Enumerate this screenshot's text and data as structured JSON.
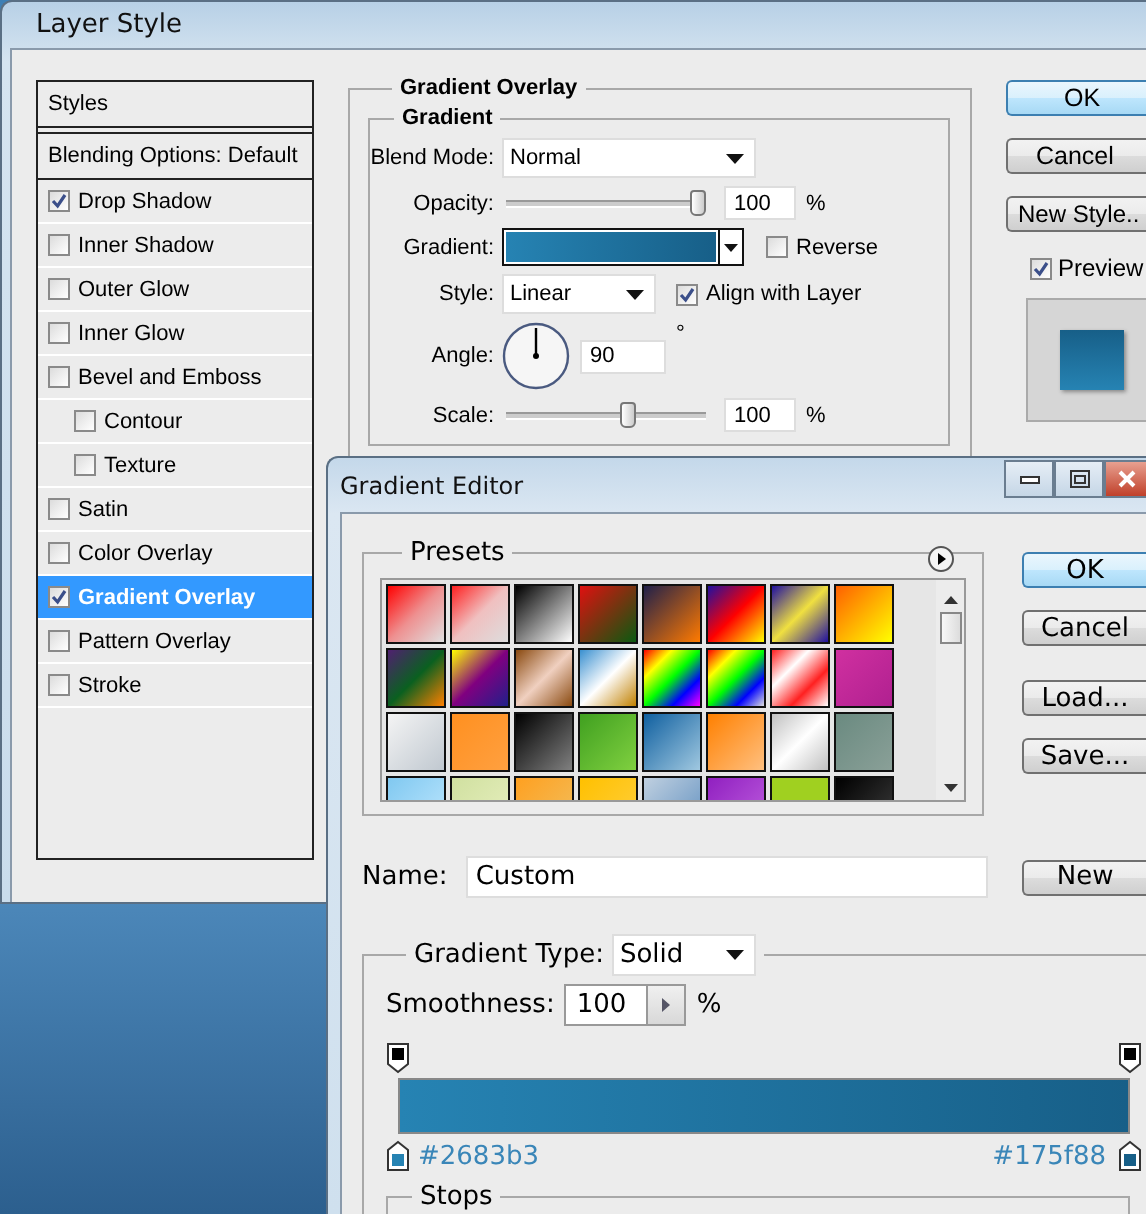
{
  "layer_style": {
    "title": "Layer Style",
    "styles_header": "Styles",
    "blending_options": "Blending Options: Default",
    "effects": [
      {
        "label": "Drop Shadow",
        "checked": true,
        "selected": false
      },
      {
        "label": "Inner Shadow",
        "checked": false,
        "selected": false
      },
      {
        "label": "Outer Glow",
        "checked": false,
        "selected": false
      },
      {
        "label": "Inner Glow",
        "checked": false,
        "selected": false
      },
      {
        "label": "Bevel and Emboss",
        "checked": false,
        "selected": false,
        "children": [
          {
            "label": "Contour",
            "checked": false,
            "selected": false
          },
          {
            "label": "Texture",
            "checked": false,
            "selected": false
          }
        ]
      },
      {
        "label": "Satin",
        "checked": false,
        "selected": false
      },
      {
        "label": "Color Overlay",
        "checked": false,
        "selected": false
      },
      {
        "label": "Gradient Overlay",
        "checked": true,
        "selected": true
      },
      {
        "label": "Pattern Overlay",
        "checked": false,
        "selected": false
      },
      {
        "label": "Stroke",
        "checked": false,
        "selected": false
      }
    ],
    "section_title": "Gradient Overlay",
    "group_title": "Gradient",
    "blend_mode": {
      "label": "Blend Mode:",
      "value": "Normal"
    },
    "opacity": {
      "label": "Opacity:",
      "level": 1,
      "value": "100",
      "unit": "%"
    },
    "gradient": {
      "label": "Gradient:",
      "stops": [
        {
          "color": "#2683b3"
        },
        {
          "color": "#175f88"
        }
      ]
    },
    "reverse": {
      "label": "Reverse",
      "checked": false
    },
    "style": {
      "label": "Style:",
      "value": "Linear"
    },
    "align_with_layer": {
      "label": "Align with Layer",
      "checked": true
    },
    "angle": {
      "label": "Angle:",
      "value": "90",
      "unit": "°"
    },
    "scale": {
      "label": "Scale:",
      "level": 0.62,
      "value": "100",
      "unit": "%"
    },
    "buttons": [
      {
        "label": "OK",
        "default": true
      },
      {
        "label": "Cancel",
        "default": false
      },
      {
        "label": "New Style..",
        "default": false
      }
    ],
    "preview": {
      "label": "Preview",
      "checked": true
    }
  },
  "gradient_editor": {
    "title": "Gradient Editor",
    "presets_title": "Presets",
    "buttons": [
      {
        "label": "OK",
        "default": true
      },
      {
        "label": "Cancel",
        "default": false
      },
      {
        "label": "Load...",
        "default": false
      },
      {
        "label": "Save...",
        "default": false
      }
    ],
    "name": {
      "label": "Name:",
      "value": "Custom"
    },
    "new_button": "New",
    "gradient_type": {
      "label": "Gradient Type:",
      "value": "Solid"
    },
    "smoothness": {
      "label": "Smoothness:",
      "value": "100",
      "unit": "%"
    },
    "color_stops": [
      {
        "color": "#2683b3",
        "label": "#2683b3"
      },
      {
        "color": "#175f88",
        "label": "#175f88"
      }
    ],
    "stops_title": "Stops"
  }
}
